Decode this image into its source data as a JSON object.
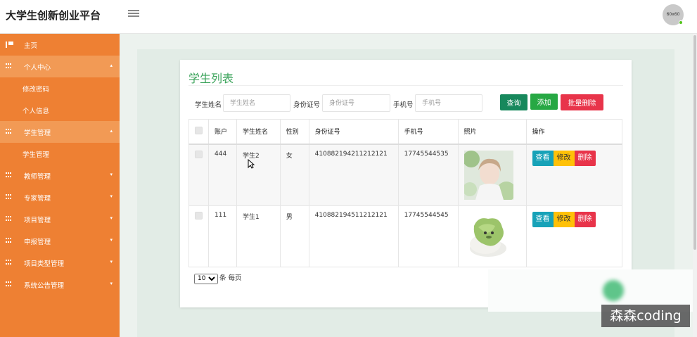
{
  "app": {
    "title": "大学生创新创业平台",
    "avatar_text": "60x60"
  },
  "sidebar": {
    "items": [
      {
        "label": "主页",
        "icon": "flag-icon"
      },
      {
        "label": "个人中心",
        "icon": "grid-icon",
        "caret": "▴"
      },
      {
        "label": "修改密码",
        "sub": true
      },
      {
        "label": "个人信息",
        "sub": true
      },
      {
        "label": "学生管理",
        "icon": "grid-icon",
        "caret": "▴"
      },
      {
        "label": "学生管理",
        "sub": true
      },
      {
        "label": "教师管理",
        "icon": "grid-icon",
        "caret": "▾"
      },
      {
        "label": "专家管理",
        "icon": "grid-icon",
        "caret": "▾"
      },
      {
        "label": "项目管理",
        "icon": "grid-icon",
        "caret": "▾"
      },
      {
        "label": "申报管理",
        "icon": "grid-icon",
        "caret": "▾"
      },
      {
        "label": "项目类型管理",
        "icon": "grid-icon",
        "caret": "▾"
      },
      {
        "label": "系统公告管理",
        "icon": "grid-icon",
        "caret": "▾"
      }
    ]
  },
  "page": {
    "title": "学生列表"
  },
  "search": {
    "name_label": "学生姓名",
    "name_placeholder": "学生姓名",
    "id_label": "身份证号",
    "id_placeholder": "身份证号",
    "phone_label": "手机号",
    "phone_placeholder": "手机号",
    "query_button": "查询",
    "add_button": "添加",
    "batch_delete_button": "批量删除"
  },
  "table": {
    "headers": [
      "账户",
      "学生姓名",
      "性别",
      "身份证号",
      "手机号",
      "照片",
      "操作"
    ],
    "rows": [
      {
        "account": "444",
        "name": "学生2",
        "gender": "女",
        "id_no": "410882194211212121",
        "phone": "17745544535"
      },
      {
        "account": "111",
        "name": "学生1",
        "gender": "男",
        "id_no": "410882194511212121",
        "phone": "17745544545"
      }
    ],
    "actions": {
      "view": "查看",
      "edit": "修改",
      "delete": "删除"
    }
  },
  "pager": {
    "page_size": "10",
    "per_page_label": "条 每页"
  },
  "watermark": "森森coding",
  "colors": {
    "sidebar": "#ee8033",
    "accent_title": "#3aa35a",
    "query": "#17885c",
    "add": "#27a844",
    "danger": "#e8344a",
    "view": "#17a2b8",
    "edit": "#ffc107"
  }
}
